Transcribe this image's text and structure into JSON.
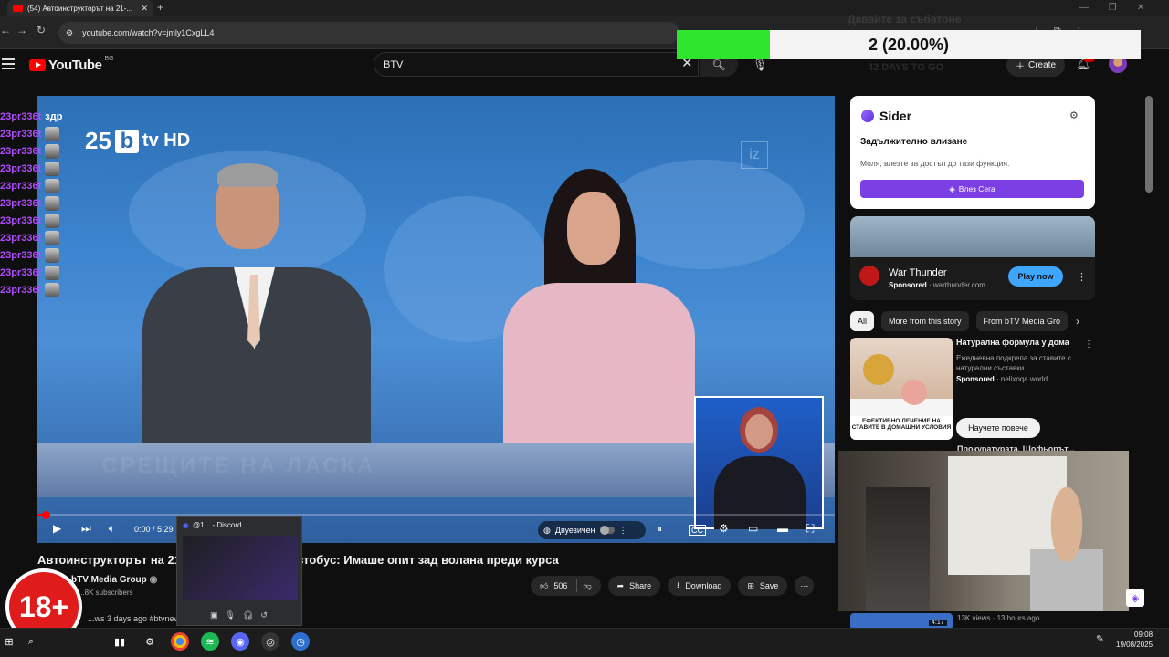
{
  "browser": {
    "tab_title": "(54) Автоинструкторът на 21-...",
    "url": "youtube.com/watch?v=jmly1CxgLL4"
  },
  "overlay": {
    "progress_text": "2 (20.00%)",
    "progress_fraction": 0.2,
    "ghost_text": "Давайте за събатоне",
    "countdown": "42 DAYS TO GO"
  },
  "header": {
    "logo_text": "YouTube",
    "region": "BG",
    "search_value": "BTV",
    "create_label": "Create",
    "notifications": "9+"
  },
  "player": {
    "channel_logo_num": "25",
    "channel_logo_b": "b",
    "channel_logo_tv": "tv HD",
    "iz_logo": "iz",
    "desk_text": "СРЕЩИТЕ НА ЛАСКА",
    "time": "0:00 / 5:29",
    "progress_fraction": 0.01,
    "dub_label": "Двуезичен"
  },
  "chat": {
    "user": "23pr336t",
    "first_message": "здр",
    "row_count": 11
  },
  "video": {
    "title": "Автоинструкторът на 21 ... тастрофирал в автобус: Имаше опит зад волана преди курса",
    "channel": "bTV Media Group",
    "subscribers": "...8K subscribers",
    "meta": "...ws  3 days ago  #btvnews #btv #btvновини",
    "likes": "506",
    "share_label": "Share",
    "download_label": "Download",
    "save_label": "Save",
    "age_badge": "18+"
  },
  "discord_preview": {
    "title": "@1... - Discord"
  },
  "sidebar": {
    "sider": {
      "brand": "Sider",
      "heading": "Задължително влизане",
      "text": "Моля, влезте за достъп до тази функция.",
      "button": "Влез Сега"
    },
    "ad": {
      "title": "War Thunder",
      "sponsored": "Sponsored",
      "domain": "warthunder.com",
      "cta": "Play now"
    },
    "chips": [
      "All",
      "More from this story",
      "From bTV Media Gro"
    ],
    "rec_ad": {
      "title": "Натурална формула у дома",
      "desc": "Ежедневна подкрепа за ставите с натурални съставки",
      "sponsored": "Sponsored",
      "domain": "nelixoqa.world",
      "banner": "ЕФЕКТИВНО ЛЕЧЕНИЕ НА СТАВИТЕ В ДОМАШНИ УСЛОВИЯ",
      "cta": "Научете повече"
    },
    "next_title": "Прокуратурата, Шофьорът...",
    "bottom": {
      "duration": "4:17",
      "meta": "13K views · 13 hours ago"
    }
  },
  "taskbar": {
    "time": "09:08",
    "date": "19/08/2025"
  },
  "colors": {
    "progress_green": "#2ee62e",
    "yt_red": "#ff0000",
    "chat_user": "#b04dff",
    "sider_purple": "#7b3fe4",
    "play_now_blue": "#3ea6ff",
    "age_red": "#e01b1b"
  }
}
